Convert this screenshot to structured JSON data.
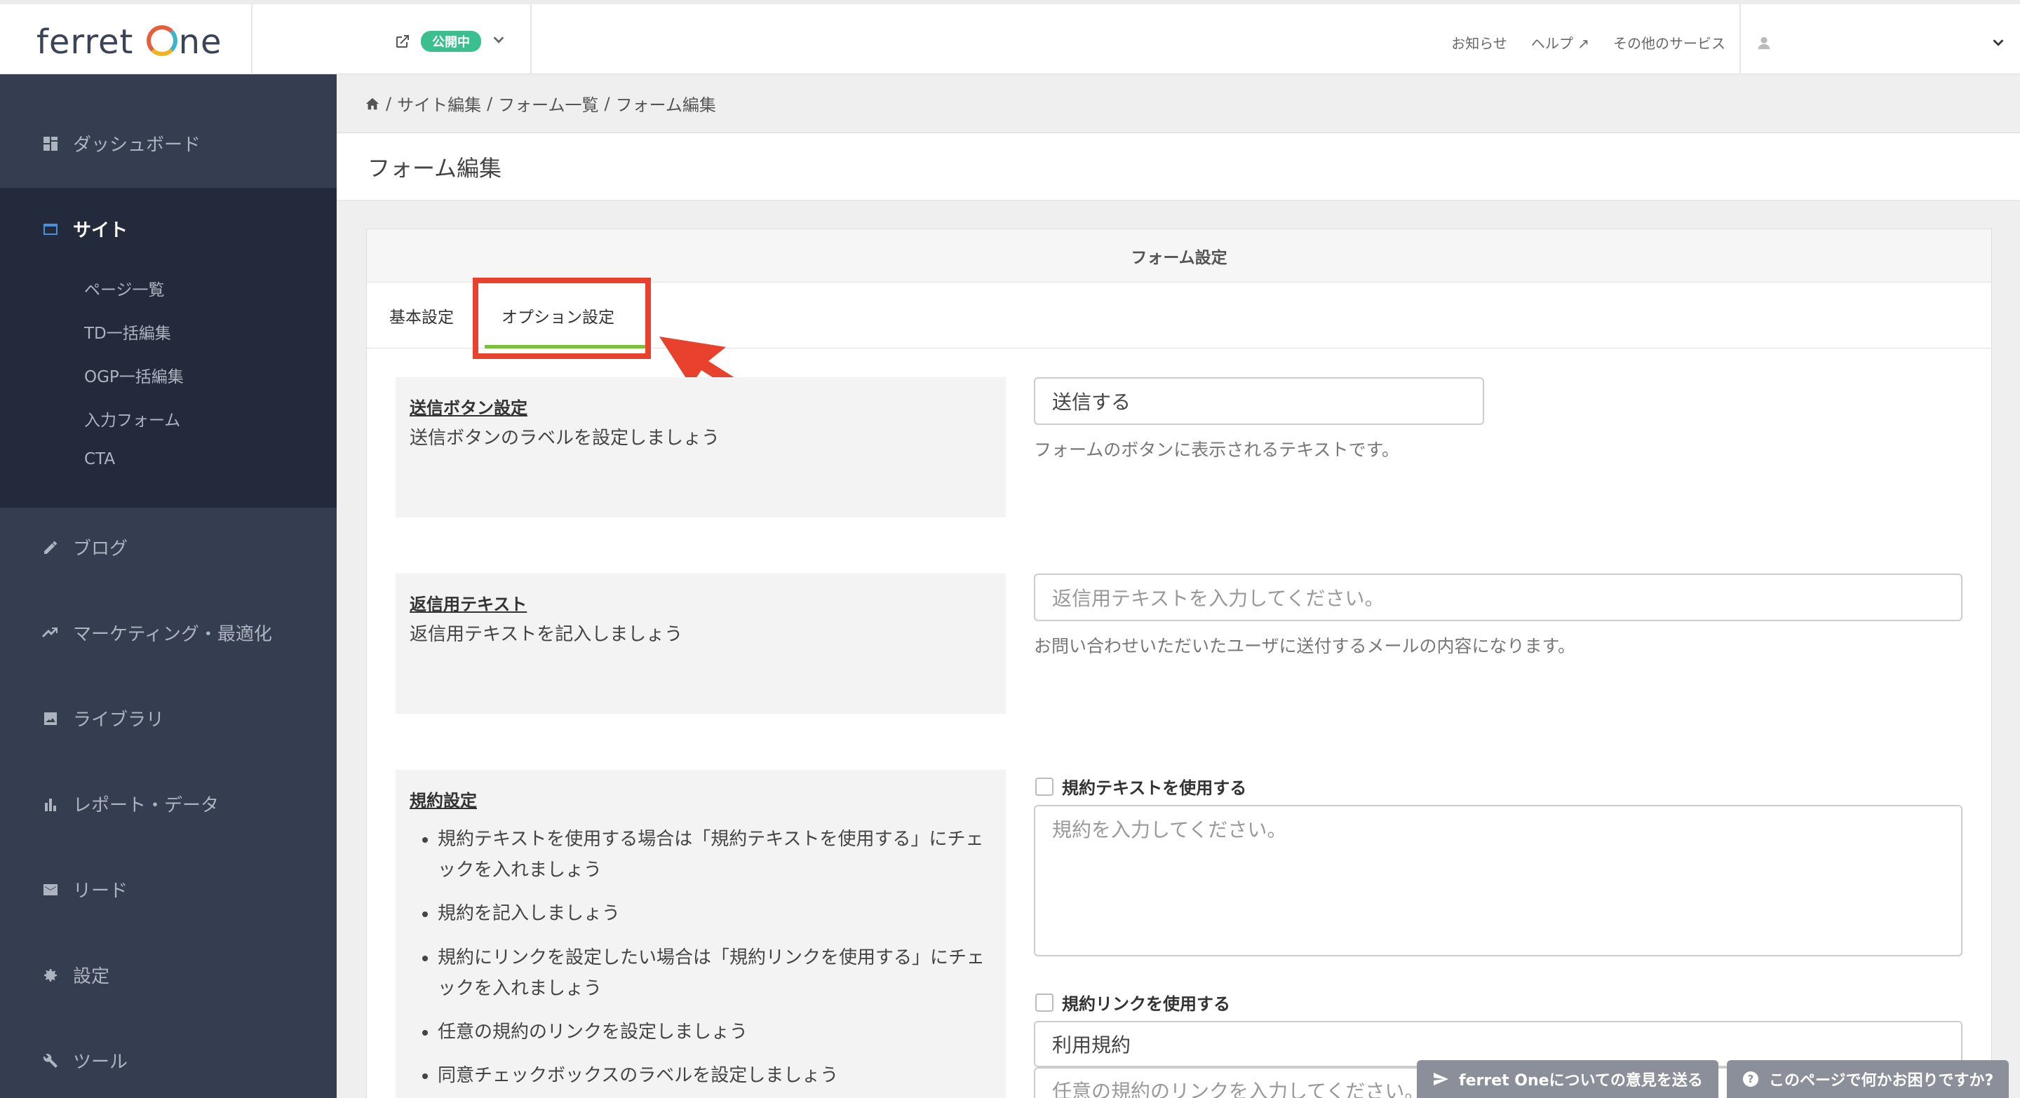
{
  "header": {
    "logo": "ferret",
    "logo_suffix": "ne",
    "status_badge": "公開中",
    "links": [
      "お知らせ",
      "ヘルプ",
      "その他のサービス"
    ]
  },
  "sidebar": {
    "items": [
      {
        "label": "ダッシュボード",
        "icon": "dashboard-icon"
      },
      {
        "label": "サイト",
        "icon": "site-icon"
      },
      {
        "label": "ブログ",
        "icon": "pencil-icon"
      },
      {
        "label": "マーケティング・最適化",
        "icon": "trend-icon"
      },
      {
        "label": "ライブラリ",
        "icon": "image-icon"
      },
      {
        "label": "レポート・データ",
        "icon": "bar-chart-icon"
      },
      {
        "label": "リード",
        "icon": "mail-icon"
      },
      {
        "label": "設定",
        "icon": "gear-icon"
      },
      {
        "label": "ツール",
        "icon": "wrench-icon"
      }
    ],
    "sub_items": [
      "ページ一覧",
      "TD一括編集",
      "OGP一括編集",
      "入力フォーム",
      "CTA"
    ]
  },
  "breadcrumb": [
    "サイト編集",
    "フォーム一覧",
    "フォーム編集"
  ],
  "page_title": "フォーム編集",
  "card": {
    "title": "フォーム設定",
    "tabs": [
      "基本設定",
      "オプション設定"
    ]
  },
  "sections": {
    "submit": {
      "label": "送信ボタン設定",
      "desc": "送信ボタンのラベルを設定しましょう",
      "value": "送信する",
      "help": "フォームのボタンに表示されるテキストです。"
    },
    "reply": {
      "label": "返信用テキスト",
      "desc": "返信用テキストを記入しましょう",
      "placeholder": "返信用テキストを入力してください。",
      "help": "お問い合わせいただいたユーザに送付するメールの内容になります。"
    },
    "terms": {
      "label": "規約設定",
      "bullets": [
        "規約テキストを使用する場合は「規約テキストを使用する」にチェックを入れましょう",
        "規約を記入しましょう",
        "規約にリンクを設定したい場合は「規約リンクを使用する」にチェックを入れましょう",
        "任意の規約のリンクを設定しましょう",
        "同意チェックボックスのラベルを設定しましょう"
      ],
      "use_text_label": "規約テキストを使用する",
      "text_placeholder": "規約を入力してください。",
      "use_link_label": "規約リンクを使用する",
      "link_label_value": "利用規約",
      "link_placeholder": "任意の規約のリンクを入力してください。"
    }
  },
  "footer_buttons": [
    "ferret Oneについての意見を送る",
    "このページで何かお困りですか?"
  ],
  "colors": {
    "accent": "#3cbf8f",
    "highlight": "#e8412e",
    "tab_active": "#7cbf3a",
    "sidebar": "#353d51"
  }
}
